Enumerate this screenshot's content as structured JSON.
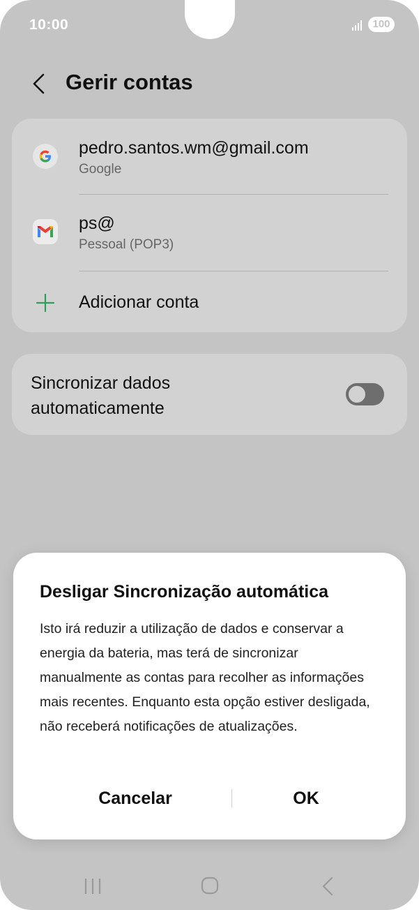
{
  "status_bar": {
    "time": "10:00",
    "battery": "100"
  },
  "header": {
    "title": "Gerir contas"
  },
  "accounts": [
    {
      "email": "pedro.santos.wm@gmail.com",
      "provider": "Google",
      "icon": "google-icon"
    },
    {
      "email": "ps@",
      "provider": "Pessoal (POP3)",
      "icon": "gmail-icon"
    }
  ],
  "add_account_label": "Adicionar conta",
  "sync": {
    "label": "Sincronizar dados automaticamente",
    "enabled": false
  },
  "dialog": {
    "title": "Desligar Sincronização automática",
    "body": "Isto irá reduzir a utilização de dados e conservar a energia da bateria, mas terá de sincronizar manualmente as contas para recolher as informações mais recentes. Enquanto esta opção estiver desligada, não receberá notificações de atualizações.",
    "cancel_label": "Cancelar",
    "ok_label": "OK"
  },
  "colors": {
    "overlay_bg": "#c4c4c4",
    "accent_green": "#2e9e5b"
  }
}
